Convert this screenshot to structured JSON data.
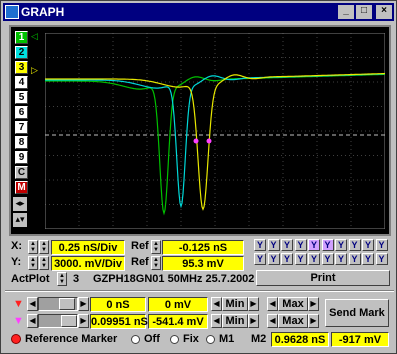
{
  "window": {
    "title": "GRAPH",
    "buttons": [
      "_",
      "□",
      "×"
    ]
  },
  "channels": [
    {
      "label": "1",
      "bg": "#00c000",
      "fg": "#ffffff"
    },
    {
      "label": "2",
      "bg": "#00e0e0",
      "fg": "#000000"
    },
    {
      "label": "3",
      "bg": "#ffff00",
      "fg": "#000000"
    },
    {
      "label": "4",
      "bg": "#ffffff",
      "fg": "#000000"
    },
    {
      "label": "5",
      "bg": "#ffffff",
      "fg": "#000000"
    },
    {
      "label": "6",
      "bg": "#ffffff",
      "fg": "#000000"
    },
    {
      "label": "7",
      "bg": "#ffffff",
      "fg": "#000000"
    },
    {
      "label": "8",
      "bg": "#ffffff",
      "fg": "#000000"
    },
    {
      "label": "9",
      "bg": "#ffffff",
      "fg": "#000000"
    },
    {
      "label": "C",
      "bg": "#c0c0c0",
      "fg": "#000000"
    },
    {
      "label": "M",
      "bg": "#c00000",
      "fg": "#ffffff"
    }
  ],
  "x_axis": {
    "label": "X:",
    "value": "0.25  nS/Div",
    "ref_label": "Ref",
    "ref_value": "-0.125  nS"
  },
  "y_axis": {
    "label": "Y:",
    "value": "3000.  mV/Div",
    "ref_label": "Ref",
    "ref_value": "95.3  mV"
  },
  "act_plot": {
    "label": "ActPlot",
    "value": "3",
    "info": "GZPH18GN01  50MHz 25.7.2002"
  },
  "print_label": "Print",
  "v_buttons": [
    "Y",
    "Y",
    "Y",
    "Y",
    "Y",
    "Y",
    "Y",
    "Y",
    "Y",
    "Y",
    "Y",
    "Y",
    "Y",
    "Y",
    "Y",
    "Y",
    "Y",
    "Y",
    "Y",
    "Y"
  ],
  "marker1": {
    "time": "0 nS",
    "volt": "0 mV",
    "min_label": "Min",
    "max_label": "Max",
    "color": "#ff2020"
  },
  "marker2": {
    "time": "0.09951 nS",
    "volt": "-541.4 mV",
    "min_label": "Min",
    "max_label": "Max",
    "color": "#ff40ff"
  },
  "send_mark_label": "Send Mark",
  "reference": {
    "label": "Reference Marker",
    "off_label": "Off",
    "fix_label": "Fix",
    "m1_label": "M1",
    "m2_label": "M2",
    "time": "0.9628 nS",
    "volt": "-917 mV"
  },
  "colors": {
    "trace_green": "#00c000",
    "trace_cyan": "#00d8d8",
    "trace_yellow": "#e8e800",
    "grid": "#808080",
    "marker_pink": "#ff40ff"
  }
}
